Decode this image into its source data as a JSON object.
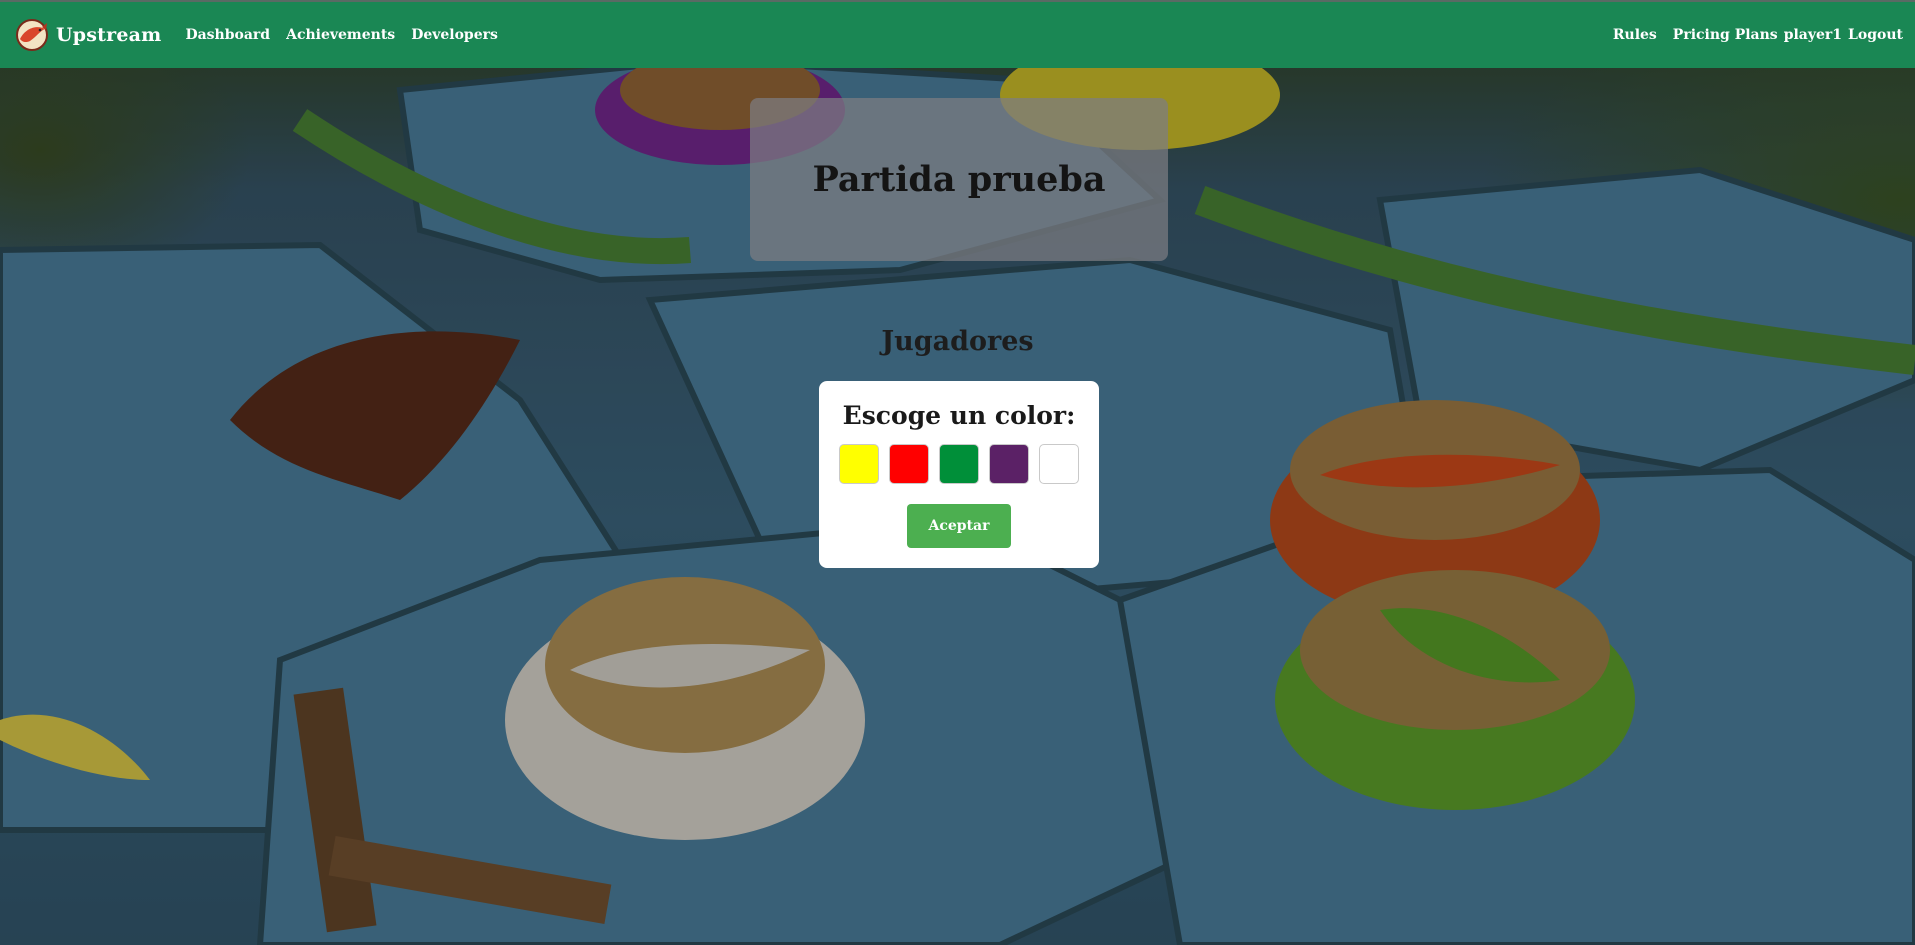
{
  "app": {
    "name": "Upstream",
    "logo_icon": "salmon-logo-icon"
  },
  "navbar": {
    "background": "#1a8754",
    "left_links": [
      "Dashboard",
      "Achievements",
      "Developers"
    ],
    "right_links": [
      "Rules",
      "Pricing Plans",
      "player1",
      "Logout"
    ]
  },
  "page": {
    "title": "Partida prueba",
    "players_heading": "Jugadores"
  },
  "color_picker": {
    "title": "Escoge un color:",
    "colors": [
      {
        "name": "yellow",
        "hex": "#ffff00"
      },
      {
        "name": "red",
        "hex": "#ff0000"
      },
      {
        "name": "green",
        "hex": "#008f39"
      },
      {
        "name": "purple",
        "hex": "#5b2166"
      },
      {
        "name": "white",
        "hex": "#ffffff"
      }
    ],
    "accept_label": "Aceptar",
    "accept_color": "#4caf50"
  }
}
